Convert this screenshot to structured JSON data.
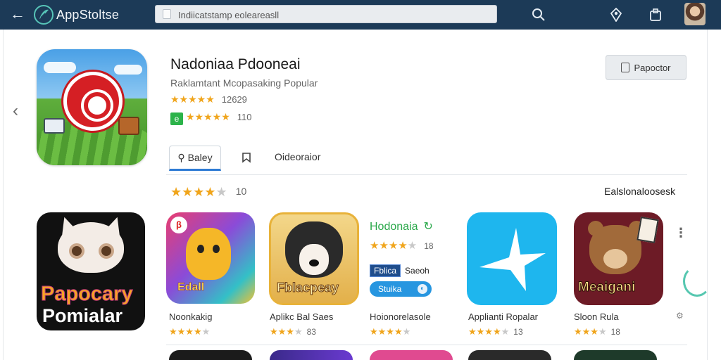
{
  "topbar": {
    "brand": "AppStoltse",
    "search_value": "Indiicatstamp eoleareasll",
    "icons": [
      "back-arrow-icon",
      "logo-icon",
      "search-icon",
      "location-pin-icon",
      "bag-icon",
      "avatar"
    ]
  },
  "featured": {
    "title": "Nadoniaa Pdooneai",
    "subtitle": "Raklamtant Mcopasaking Popular",
    "rating_count_1": "12629",
    "rating_count_2": "110",
    "badge": "e",
    "action_label": "Papoctor"
  },
  "tabs": [
    {
      "label": "Baley"
    },
    {
      "label": ""
    },
    {
      "label": "Oideoraior"
    }
  ],
  "rating_summary": {
    "value": "10"
  },
  "section_link": "Ealslonaloosesk ",
  "apps": [
    {
      "caption": "Noonkakig",
      "icon_line1": "Papocary",
      "icon_line2": "Pomialar",
      "rating_count": ""
    },
    {
      "caption": "Aplikc Bal Saes",
      "icon_text": "Edall",
      "rating_count": "83"
    },
    {
      "caption": "Hoionorelasole",
      "icon_text": "Fblacpeay",
      "rating_count": ""
    },
    {
      "caption": "Applianti Ropalar",
      "rating_count": "13"
    },
    {
      "caption": "Sloon Rula",
      "icon_text": "Meaigani",
      "rating_count": "18"
    }
  ],
  "mid_block": {
    "title": "Hodonaia",
    "rating_count": "18",
    "tag_box": "Fblica",
    "tag_text": "Saeoh",
    "button_label": "Stuika"
  },
  "colors": {
    "topbar": "#1c3a57",
    "accent_blue": "#2e7bd4",
    "star": "#f0a51c",
    "green": "#2aa84a"
  }
}
